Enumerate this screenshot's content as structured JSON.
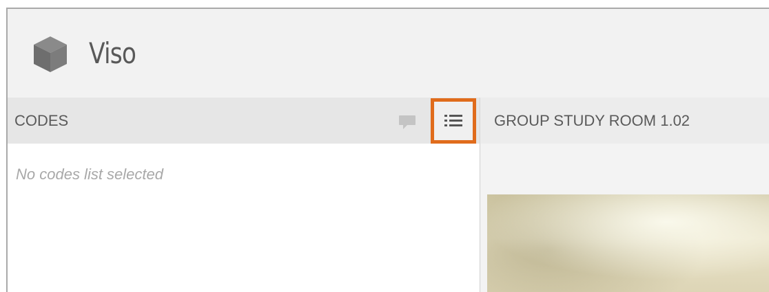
{
  "app": {
    "name": "Viso",
    "logo_icon": "cube-logo-icon"
  },
  "codes_panel": {
    "title": "CODES",
    "comment_icon": "comment-icon",
    "list_icon": "list-icon",
    "empty_message": "No codes list selected"
  },
  "room_panel": {
    "title": "GROUP STUDY ROOM 1.02"
  },
  "colors": {
    "highlight": "#e06c1c",
    "topbar": "#f2f2f2",
    "header": "#e6e6e6"
  }
}
